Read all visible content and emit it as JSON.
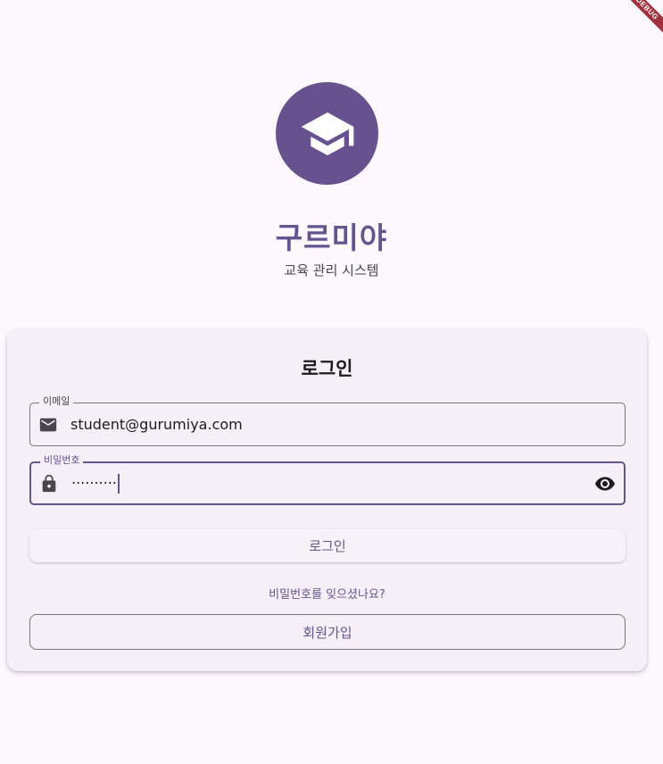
{
  "debug_banner": "DEBUG",
  "app": {
    "title": "구르미야",
    "subtitle": "교육 관리 시스템",
    "logo_icon": "graduation-cap-icon",
    "brand_color": "#65558f"
  },
  "login_card": {
    "title": "로그인",
    "email": {
      "label": "이메일",
      "value": "student@gurumiya.com",
      "icon": "email-icon"
    },
    "password": {
      "label": "비밀번호",
      "masked_value": "··········",
      "icon": "lock-icon",
      "toggle_icon": "visibility-eye-icon"
    },
    "login_button": "로그인",
    "forgot_password_link": "비밀번호를 잊으셨나요?",
    "signup_button": "회원가입"
  }
}
